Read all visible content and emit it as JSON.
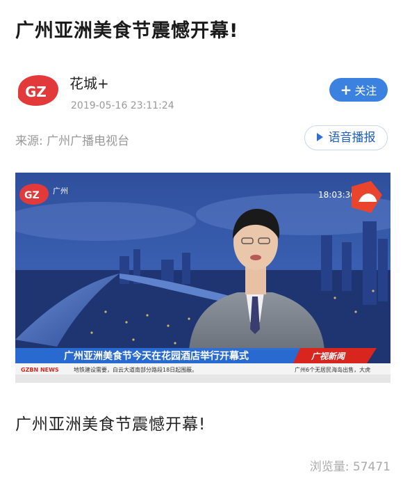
{
  "article": {
    "title": "广州亚洲美食节震憾开幕!",
    "body": "广州亚洲美食节震憾开幕!"
  },
  "author": {
    "logo_text": "GZ",
    "name": "花城+",
    "time": "2019-05-16 23:11:24",
    "follow_label": "关注",
    "follow_icon": "plus-icon"
  },
  "source": {
    "text": "来源: 广州广播电视台",
    "voice_label": "语音播报",
    "voice_icon": "play-icon"
  },
  "video": {
    "channel_logo": "GZ",
    "channel_city": "广州",
    "clock": "18:03:36",
    "headline": "广州亚洲美食节今天在花园酒店举行开幕式",
    "program": "广视新闻",
    "ticker_brand": "GZBN NEWS",
    "ticker_left": "地铁建设需要，白云大道南部分路段18日起围蔽。",
    "ticker_right": "广州6个无居民海岛出售，大虎"
  },
  "stats": {
    "views_label": "浏览量: 57471"
  },
  "colors": {
    "follow_bg": "#3b82e0",
    "voice_text": "#1f5fbf",
    "logo_red": "#e23a3a",
    "headline_bar": "#2a6fd8",
    "program_bg": "#d8261f"
  }
}
